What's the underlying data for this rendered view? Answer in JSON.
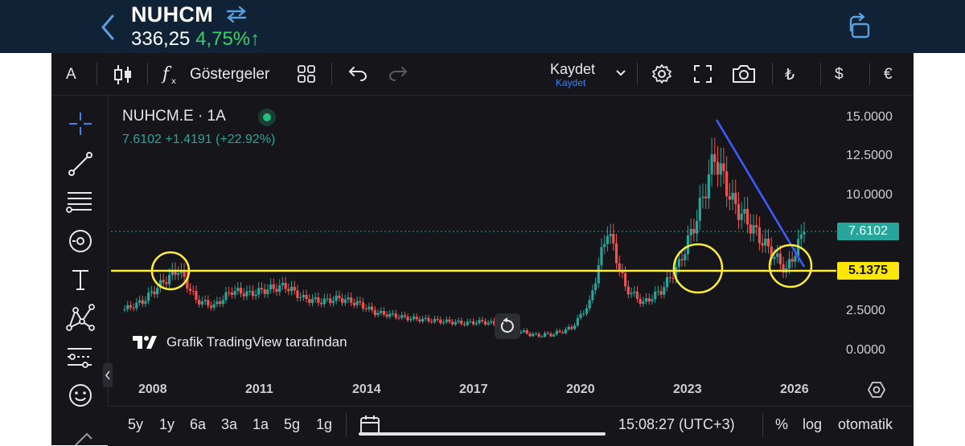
{
  "header": {
    "symbol": "NUHCM",
    "price": "336,25",
    "change": "4,75%↑"
  },
  "toolbar": {
    "font_label": "A",
    "indicators_label": "Göstergeler",
    "save_label": "Kaydet",
    "save_sub": "Kaydet",
    "currency_try": "₺",
    "currency_usd": "$",
    "currency_eur": "€"
  },
  "legend": {
    "title": "NUHCM.E · 1A",
    "values": "7.6102  +1.4191 (+22.92%)"
  },
  "y_axis": {
    "ticks": [
      "15.0000",
      "12.5000",
      "10.0000",
      "2.5000",
      "0.0000"
    ],
    "current_price": "7.6102",
    "line_price": "5.1375"
  },
  "x_axis": {
    "ticks": [
      "2008",
      "2011",
      "2014",
      "2017",
      "2020",
      "2023",
      "2026"
    ]
  },
  "attribution": "Grafik TradingView tarafından",
  "bottom": {
    "ranges": [
      "5y",
      "1y",
      "6a",
      "3a",
      "1a",
      "5g",
      "1g"
    ],
    "time": "15:08:27 (UTC+3)",
    "percent": "%",
    "log": "log",
    "auto": "otomatik"
  },
  "chart_data": {
    "type": "candlestick",
    "series_name": "NUHCM.E · 1A",
    "x": [
      "2007.0",
      "2007.5",
      "2008.0",
      "2008.5",
      "2009.0",
      "2009.5",
      "2010.0",
      "2010.5",
      "2011.0",
      "2011.5",
      "2012.0",
      "2012.5",
      "2013.0",
      "2013.5",
      "2014.0",
      "2014.5",
      "2015.0",
      "2015.5",
      "2016.0",
      "2016.5",
      "2017.0",
      "2017.5",
      "2018.0",
      "2018.5",
      "2019.0",
      "2019.5",
      "2020.0",
      "2020.5",
      "2021.0",
      "2021.5",
      "2022.0",
      "2022.5",
      "2023.0",
      "2023.5",
      "2024.0",
      "2024.5",
      "2025.0",
      "2025.5",
      "2026.0"
    ],
    "close": [
      2.6,
      3.1,
      4.2,
      5.2,
      3.2,
      2.8,
      3.8,
      3.6,
      3.9,
      4.1,
      3.3,
      3.1,
      3.3,
      3.0,
      2.4,
      2.2,
      2.0,
      1.9,
      1.8,
      1.7,
      1.8,
      1.6,
      1.2,
      0.9,
      1.0,
      1.4,
      3.0,
      7.8,
      4.0,
      3.0,
      3.8,
      5.5,
      8.5,
      12.5,
      9.5,
      8.0,
      6.5,
      5.1,
      7.6
    ],
    "ylim": [
      0,
      15
    ],
    "yticks": [
      0,
      2.5,
      10,
      12.5,
      15
    ],
    "horizontal_line": 5.1375,
    "last_value": 7.6102,
    "colors": {
      "up": "#26a69a",
      "down": "#ef5350",
      "line": "#ffeb3b",
      "trend": "#3d5afe"
    }
  }
}
